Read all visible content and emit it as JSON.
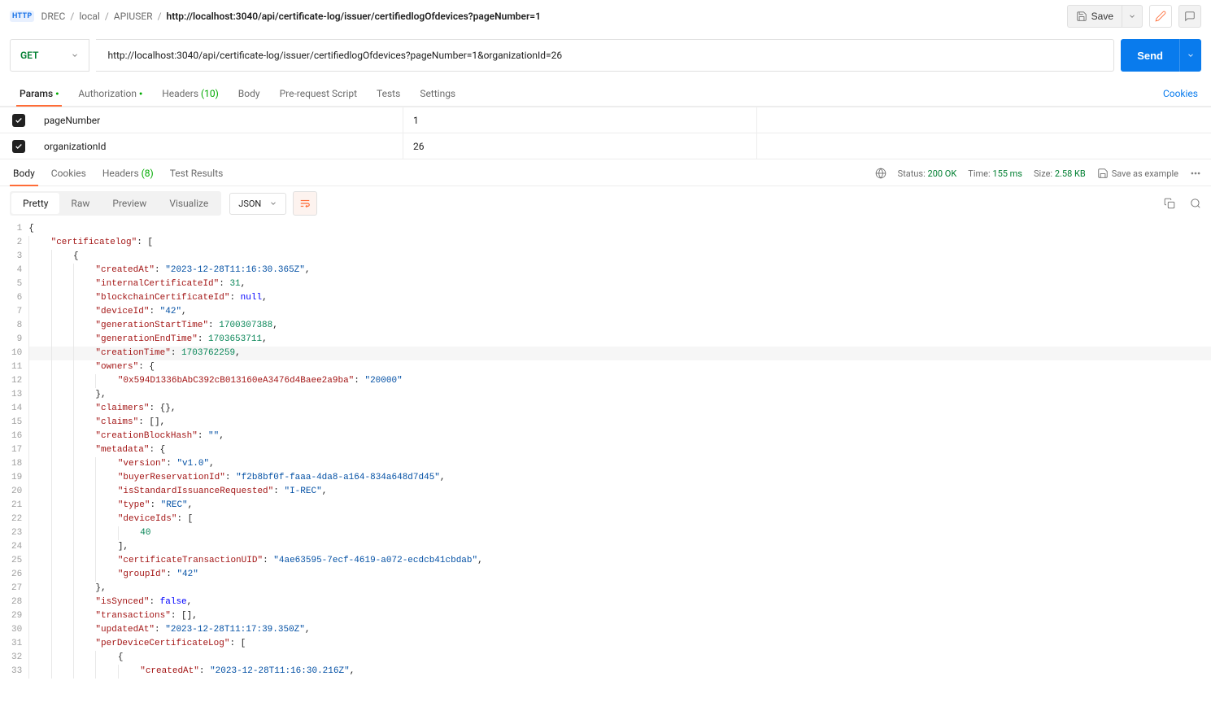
{
  "breadcrumb": {
    "root": "DREC",
    "l1": "local",
    "l2": "APIUSER",
    "current": "http://localhost:3040/api/certificate-log/issuer/certifiedlogOfdevices?pageNumber=1"
  },
  "topActions": {
    "save": "Save"
  },
  "request": {
    "method": "GET",
    "url": "http://localhost:3040/api/certificate-log/issuer/certifiedlogOfdevices?pageNumber=1&organizationId=26",
    "send": "Send"
  },
  "reqTabs": {
    "params": "Params",
    "auth": "Authorization",
    "headers": "Headers",
    "headersCount": "(10)",
    "body": "Body",
    "prereq": "Pre-request Script",
    "tests": "Tests",
    "settings": "Settings",
    "cookies": "Cookies"
  },
  "params": [
    {
      "key": "pageNumber",
      "value": "1"
    },
    {
      "key": "organizationId",
      "value": "26"
    }
  ],
  "respTabs": {
    "body": "Body",
    "cookies": "Cookies",
    "headers": "Headers",
    "headersCount": "(8)",
    "testResults": "Test Results"
  },
  "respMeta": {
    "statusLabel": "Status:",
    "status": "200 OK",
    "timeLabel": "Time:",
    "time": "155 ms",
    "sizeLabel": "Size:",
    "size": "2.58 KB",
    "saveExample": "Save as example"
  },
  "viewTabs": {
    "pretty": "Pretty",
    "raw": "Raw",
    "preview": "Preview",
    "visualize": "Visualize",
    "format": "JSON"
  },
  "code": {
    "lines": [
      {
        "n": 1,
        "ind": 0,
        "t": [
          [
            "punc",
            "{"
          ]
        ]
      },
      {
        "n": 2,
        "ind": 1,
        "t": [
          [
            "key",
            "\"certificatelog\""
          ],
          [
            "punc",
            ": ["
          ]
        ]
      },
      {
        "n": 3,
        "ind": 2,
        "t": [
          [
            "punc",
            "{"
          ]
        ]
      },
      {
        "n": 4,
        "ind": 3,
        "t": [
          [
            "key",
            "\"createdAt\""
          ],
          [
            "punc",
            ": "
          ],
          [
            "str",
            "\"2023-12-28T11:16:30.365Z\""
          ],
          [
            "punc",
            ","
          ]
        ]
      },
      {
        "n": 5,
        "ind": 3,
        "t": [
          [
            "key",
            "\"internalCertificateId\""
          ],
          [
            "punc",
            ": "
          ],
          [
            "num",
            "31"
          ],
          [
            "punc",
            ","
          ]
        ]
      },
      {
        "n": 6,
        "ind": 3,
        "t": [
          [
            "key",
            "\"blockchainCertificateId\""
          ],
          [
            "punc",
            ": "
          ],
          [
            "kw",
            "null"
          ],
          [
            "punc",
            ","
          ]
        ]
      },
      {
        "n": 7,
        "ind": 3,
        "t": [
          [
            "key",
            "\"deviceId\""
          ],
          [
            "punc",
            ": "
          ],
          [
            "str",
            "\"42\""
          ],
          [
            "punc",
            ","
          ]
        ]
      },
      {
        "n": 8,
        "ind": 3,
        "t": [
          [
            "key",
            "\"generationStartTime\""
          ],
          [
            "punc",
            ": "
          ],
          [
            "num",
            "1700307388"
          ],
          [
            "punc",
            ","
          ]
        ]
      },
      {
        "n": 9,
        "ind": 3,
        "t": [
          [
            "key",
            "\"generationEndTime\""
          ],
          [
            "punc",
            ": "
          ],
          [
            "num",
            "1703653711"
          ],
          [
            "punc",
            ","
          ]
        ]
      },
      {
        "n": 10,
        "ind": 3,
        "hl": true,
        "t": [
          [
            "key",
            "\"creationTime\""
          ],
          [
            "punc",
            ": "
          ],
          [
            "num",
            "1703762259"
          ],
          [
            "punc",
            ","
          ]
        ]
      },
      {
        "n": 11,
        "ind": 3,
        "t": [
          [
            "key",
            "\"owners\""
          ],
          [
            "punc",
            ": {"
          ]
        ]
      },
      {
        "n": 12,
        "ind": 4,
        "t": [
          [
            "key",
            "\"0x594D1336bAbC392cB013160eA3476d4Baee2a9ba\""
          ],
          [
            "punc",
            ": "
          ],
          [
            "str",
            "\"20000\""
          ]
        ]
      },
      {
        "n": 13,
        "ind": 3,
        "t": [
          [
            "punc",
            "},"
          ]
        ]
      },
      {
        "n": 14,
        "ind": 3,
        "t": [
          [
            "key",
            "\"claimers\""
          ],
          [
            "punc",
            ": {},"
          ]
        ]
      },
      {
        "n": 15,
        "ind": 3,
        "t": [
          [
            "key",
            "\"claims\""
          ],
          [
            "punc",
            ": [],"
          ]
        ]
      },
      {
        "n": 16,
        "ind": 3,
        "t": [
          [
            "key",
            "\"creationBlockHash\""
          ],
          [
            "punc",
            ": "
          ],
          [
            "str",
            "\"\""
          ],
          [
            "punc",
            ","
          ]
        ]
      },
      {
        "n": 17,
        "ind": 3,
        "t": [
          [
            "key",
            "\"metadata\""
          ],
          [
            "punc",
            ": {"
          ]
        ]
      },
      {
        "n": 18,
        "ind": 4,
        "t": [
          [
            "key",
            "\"version\""
          ],
          [
            "punc",
            ": "
          ],
          [
            "str",
            "\"v1.0\""
          ],
          [
            "punc",
            ","
          ]
        ]
      },
      {
        "n": 19,
        "ind": 4,
        "t": [
          [
            "key",
            "\"buyerReservationId\""
          ],
          [
            "punc",
            ": "
          ],
          [
            "str",
            "\"f2b8bf0f-faaa-4da8-a164-834a648d7d45\""
          ],
          [
            "punc",
            ","
          ]
        ]
      },
      {
        "n": 20,
        "ind": 4,
        "t": [
          [
            "key",
            "\"isStandardIssuanceRequested\""
          ],
          [
            "punc",
            ": "
          ],
          [
            "str",
            "\"I-REC\""
          ],
          [
            "punc",
            ","
          ]
        ]
      },
      {
        "n": 21,
        "ind": 4,
        "t": [
          [
            "key",
            "\"type\""
          ],
          [
            "punc",
            ": "
          ],
          [
            "str",
            "\"REC\""
          ],
          [
            "punc",
            ","
          ]
        ]
      },
      {
        "n": 22,
        "ind": 4,
        "t": [
          [
            "key",
            "\"deviceIds\""
          ],
          [
            "punc",
            ": ["
          ]
        ]
      },
      {
        "n": 23,
        "ind": 5,
        "t": [
          [
            "num",
            "40"
          ]
        ]
      },
      {
        "n": 24,
        "ind": 4,
        "t": [
          [
            "punc",
            "],"
          ]
        ]
      },
      {
        "n": 25,
        "ind": 4,
        "t": [
          [
            "key",
            "\"certificateTransactionUID\""
          ],
          [
            "punc",
            ": "
          ],
          [
            "str",
            "\"4ae63595-7ecf-4619-a072-ecdcb41cbdab\""
          ],
          [
            "punc",
            ","
          ]
        ]
      },
      {
        "n": 26,
        "ind": 4,
        "t": [
          [
            "key",
            "\"groupId\""
          ],
          [
            "punc",
            ": "
          ],
          [
            "str",
            "\"42\""
          ]
        ]
      },
      {
        "n": 27,
        "ind": 3,
        "t": [
          [
            "punc",
            "},"
          ]
        ]
      },
      {
        "n": 28,
        "ind": 3,
        "t": [
          [
            "key",
            "\"isSynced\""
          ],
          [
            "punc",
            ": "
          ],
          [
            "kw",
            "false"
          ],
          [
            "punc",
            ","
          ]
        ]
      },
      {
        "n": 29,
        "ind": 3,
        "t": [
          [
            "key",
            "\"transactions\""
          ],
          [
            "punc",
            ": [],"
          ]
        ]
      },
      {
        "n": 30,
        "ind": 3,
        "t": [
          [
            "key",
            "\"updatedAt\""
          ],
          [
            "punc",
            ": "
          ],
          [
            "str",
            "\"2023-12-28T11:17:39.350Z\""
          ],
          [
            "punc",
            ","
          ]
        ]
      },
      {
        "n": 31,
        "ind": 3,
        "t": [
          [
            "key",
            "\"perDeviceCertificateLog\""
          ],
          [
            "punc",
            ": ["
          ]
        ]
      },
      {
        "n": 32,
        "ind": 4,
        "t": [
          [
            "punc",
            "{"
          ]
        ]
      },
      {
        "n": 33,
        "ind": 5,
        "t": [
          [
            "key",
            "\"createdAt\""
          ],
          [
            "punc",
            ": "
          ],
          [
            "str",
            "\"2023-12-28T11:16:30.216Z\""
          ],
          [
            "punc",
            ","
          ]
        ]
      }
    ]
  }
}
